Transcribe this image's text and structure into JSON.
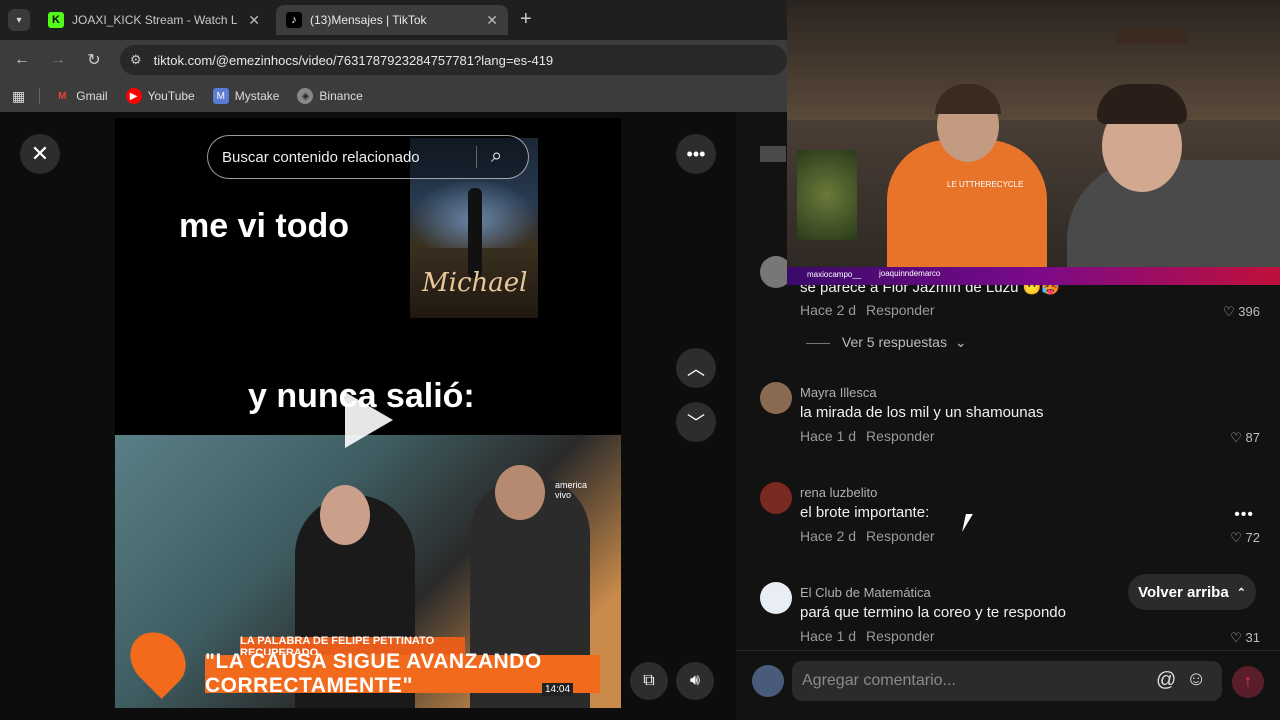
{
  "tabs": [
    {
      "title": "JOAXI_KICK Stream - Watch Live",
      "icon": "kick-icon",
      "color": "#53fc18"
    },
    {
      "title": "(13)Mensajes | TikTok",
      "icon": "tiktok-icon",
      "color": "#ffffff"
    }
  ],
  "url": "tiktok.com/@emezinhocs/video/7631787923284757781?lang=es-419",
  "bookmarks": [
    {
      "label": "Gmail",
      "icon": "gmail-icon"
    },
    {
      "label": "YouTube",
      "icon": "youtube-icon"
    },
    {
      "label": "Mystake",
      "icon": "mystake-icon"
    },
    {
      "label": "Binance",
      "icon": "binance-icon"
    }
  ],
  "video": {
    "search_placeholder": "Buscar contenido relacionado",
    "caption_top": "me vi todo",
    "caption_bottom": "y nunca salió:",
    "poster_title": "Michael",
    "banner_small": "LA PALABRA DE FELIPE PETTINATO RECUPERADO",
    "banner_big": "\"LA CAUSA SIGUE AVANZANDO CORRECTAMENTE\"",
    "time": "14:04",
    "watermark": "america vivo"
  },
  "comments": [
    {
      "name": "",
      "text": "se parece a Flor Jazmín de Luzu 😶🥵",
      "age": "Hace 2 d",
      "reply": "Responder",
      "likes": "396"
    },
    {
      "name": "Mayra Illesca",
      "text": "la mirada de los mil y un shamounas",
      "age": "Hace 1 d",
      "reply": "Responder",
      "likes": "87"
    },
    {
      "name": "rena luzbelito",
      "text": "el brote importante:",
      "age": "Hace 2 d",
      "reply": "Responder",
      "likes": "72"
    },
    {
      "name": "El Club de Matemática",
      "text": "pará que termino la coreo y te respondo",
      "age": "Hace 1 d",
      "reply": "Responder",
      "likes": "31"
    }
  ],
  "replies_toggle": "Ver 5 respuestas",
  "back_to_top": "Volver arriba",
  "comment_placeholder": "Agregar comentario...",
  "webcam": {
    "name_left": "maxiocampo__",
    "name_right": "joaquinndemarco",
    "shirt_text": "LE UTTHERECYCLE"
  },
  "colors": {
    "accent": "#fe2c55",
    "banner": "#f26a1b",
    "overlay_bar": "#6a0dad"
  }
}
